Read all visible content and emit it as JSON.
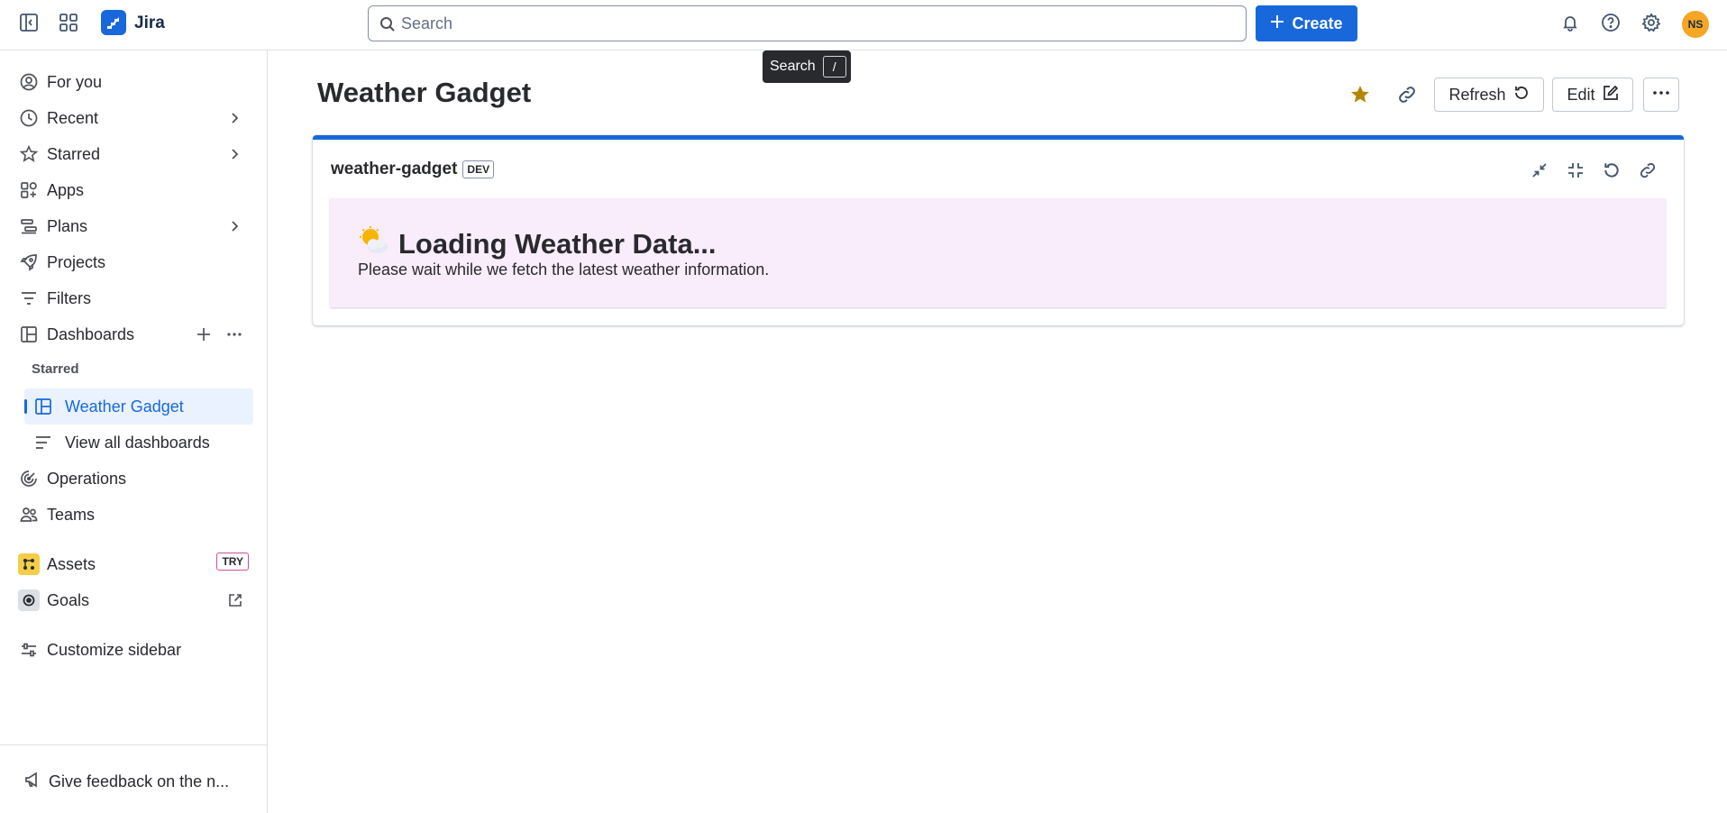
{
  "app": {
    "name": "Jira"
  },
  "search": {
    "placeholder": "Search",
    "tooltip_label": "Search",
    "tooltip_key": "/"
  },
  "header": {
    "create_label": "Create",
    "avatar_initials": "NS"
  },
  "sidebar": {
    "items": [
      {
        "label": "For you"
      },
      {
        "label": "Recent"
      },
      {
        "label": "Starred"
      },
      {
        "label": "Apps"
      },
      {
        "label": "Plans"
      },
      {
        "label": "Projects"
      },
      {
        "label": "Filters"
      },
      {
        "label": "Dashboards"
      }
    ],
    "starred_section": "Starred",
    "dashboards": [
      {
        "label": "Weather Gadget"
      },
      {
        "label": "View all dashboards"
      }
    ],
    "more_items": [
      {
        "label": "Operations"
      },
      {
        "label": "Teams"
      }
    ],
    "assets": {
      "label": "Assets",
      "badge": "TRY"
    },
    "goals": {
      "label": "Goals"
    },
    "customize": "Customize sidebar",
    "feedback": "Give feedback on the n..."
  },
  "main": {
    "title": "Weather Gadget",
    "refresh_label": "Refresh",
    "edit_label": "Edit",
    "gadget": {
      "title": "weather-gadget",
      "badge": "DEV",
      "heading": "Loading Weather Data...",
      "message": "Please wait while we fetch the latest weather information."
    }
  },
  "colors": {
    "brand": "#1868db",
    "star": "#b38600",
    "gadget_bg": "#f9ecfb"
  }
}
